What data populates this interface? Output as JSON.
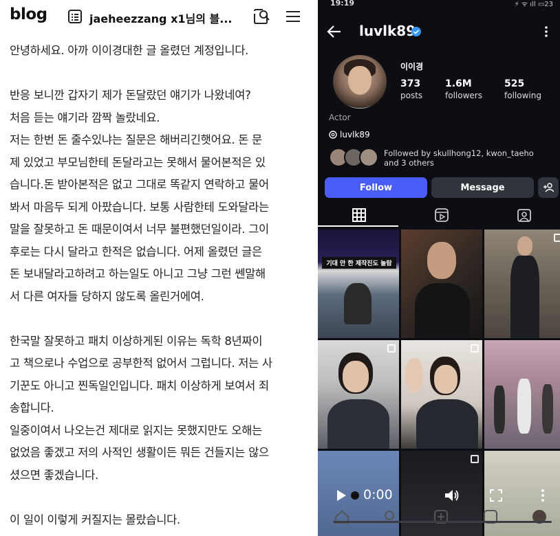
{
  "blog": {
    "logo": "blog",
    "title": "jaeheezzang x1님의 블...",
    "lines": [
      "안녕하세요. 아까 이이경대한 글 올렸던 계정입니다.",
      "",
      "반응 보니깐 갑자기 제가 돈달랐던 얘기가 나왔네여?",
      "처음 듣는 얘기라 깜짝 놀랐네요.",
      "저는 한번 돈 줄수있냐는 질문은 해버리긴햇어요. 돈 문",
      "제 있었고 부모님한테 돈달라고는 못해서 물어본적은 있",
      "습니다.돈 받아본적은 없고 그대로 똑같지 연락하고 물어",
      "봐서 마음두 되게 아팠습니다. 보통 사람한테 도와달라는",
      "말을 잘못하고 돈 때문이여서 너무 불편했던일이라. 그이",
      "후로는 다시 달라고 한적은 없습니다. 어제 올렸던 글은",
      "돈 보내달라고하려고 하는일도 아니고 그냥 그런 쎈말해",
      "서 다른 여자들 당하지 않도록 올린거에여.",
      "",
      "한국말 잘못하고 패치 이상하게된 이유는 독학 8년짜이",
      "고 책으로나 수업으로 공부한적 없어서 그럽니다. 저는 사",
      "기꾼도 아니고 찐독일인입니다. 패치 이상하게 보여서 죄",
      "송합니다.",
      "일중이여서 나오는건 제대로 읽지는 못했지만도 오해는",
      "없었음 좋겠고 저의 사적인 생활이든 뭐든 건들지는 않으",
      "셨으면 좋겠습니다.",
      "",
      "이 일이 이렇게 커질지는 몰랐습니다."
    ]
  },
  "instagram": {
    "status_time": "19:19",
    "status_right": "⚡ ᯤ ıll ▭23",
    "username": "luvlk89",
    "name": "이이경",
    "posts": {
      "num": "373",
      "label": "posts"
    },
    "followers": {
      "num": "1.6M",
      "label": "followers"
    },
    "following": {
      "num": "525",
      "label": "following"
    },
    "category": "Actor",
    "threads_handle": "luvlk89",
    "followed_by_line1": "Followed by skullhong12, kwon_taeho",
    "followed_by_line2": "and 3 others",
    "follow_label": "Follow",
    "message_label": "Message",
    "video_time": "0:00",
    "grid_caption_1": "기대 안 한 제작진도 놀람"
  },
  "colors": {
    "ig_bg": "#0c0e13",
    "follow_blue": "#4a5df9",
    "button_gray": "#30343b",
    "verified_blue": "#3897f0"
  }
}
